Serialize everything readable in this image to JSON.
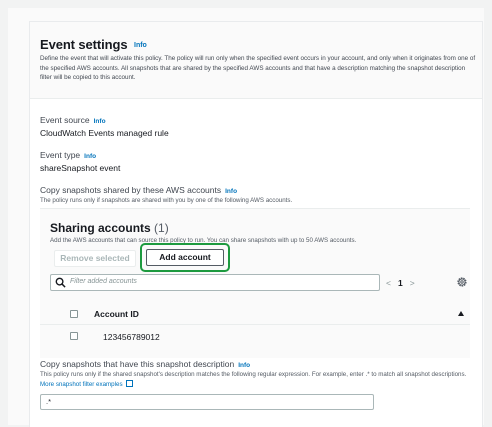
{
  "header": {
    "title": "Event settings",
    "info": "Info",
    "description": "Define the event that will activate this policy. The policy will run only when the specified event occurs in your account, and only when it originates from one of the specified AWS accounts. All snapshots that are shared by the specified AWS accounts and that have a description matching the snapshot description filter will be copied to this account."
  },
  "event_source": {
    "label": "Event source",
    "info": "Info",
    "value": "CloudWatch Events managed rule"
  },
  "event_type": {
    "label": "Event type",
    "info": "Info",
    "value": "shareSnapshot event"
  },
  "copy_shared": {
    "label": "Copy snapshots shared by these AWS accounts",
    "info": "Info",
    "help": "The policy runs only if snapshots are shared with you by one of the following AWS accounts."
  },
  "sharing": {
    "title": "Sharing accounts",
    "count": "(1)",
    "description": "Add the AWS accounts that can source this policy to run. You can share snapshots with up to 50 AWS accounts.",
    "remove_label": "Remove selected",
    "add_label": "Add account",
    "search_placeholder": "Filter added accounts",
    "page_prev": "<",
    "page_number": "1",
    "page_next": ">",
    "column_header": "Account ID",
    "rows": [
      {
        "account_id": "123456789012"
      }
    ]
  },
  "description_filter": {
    "label": "Copy snapshots that have this snapshot description",
    "info": "Info",
    "help": "This policy runs only if the shared snapshot's description matches the following regular expression. For example, enter .* to match all snapshot descriptions.",
    "link": "More snapshot filter examples",
    "value": ".*"
  },
  "colors": {
    "link": "#0073bb",
    "highlight": "#1d9a3f",
    "text": "#16191f"
  },
  "icons": [
    "search-icon",
    "gear-icon",
    "sort-ascending-icon",
    "external-link-icon"
  ]
}
